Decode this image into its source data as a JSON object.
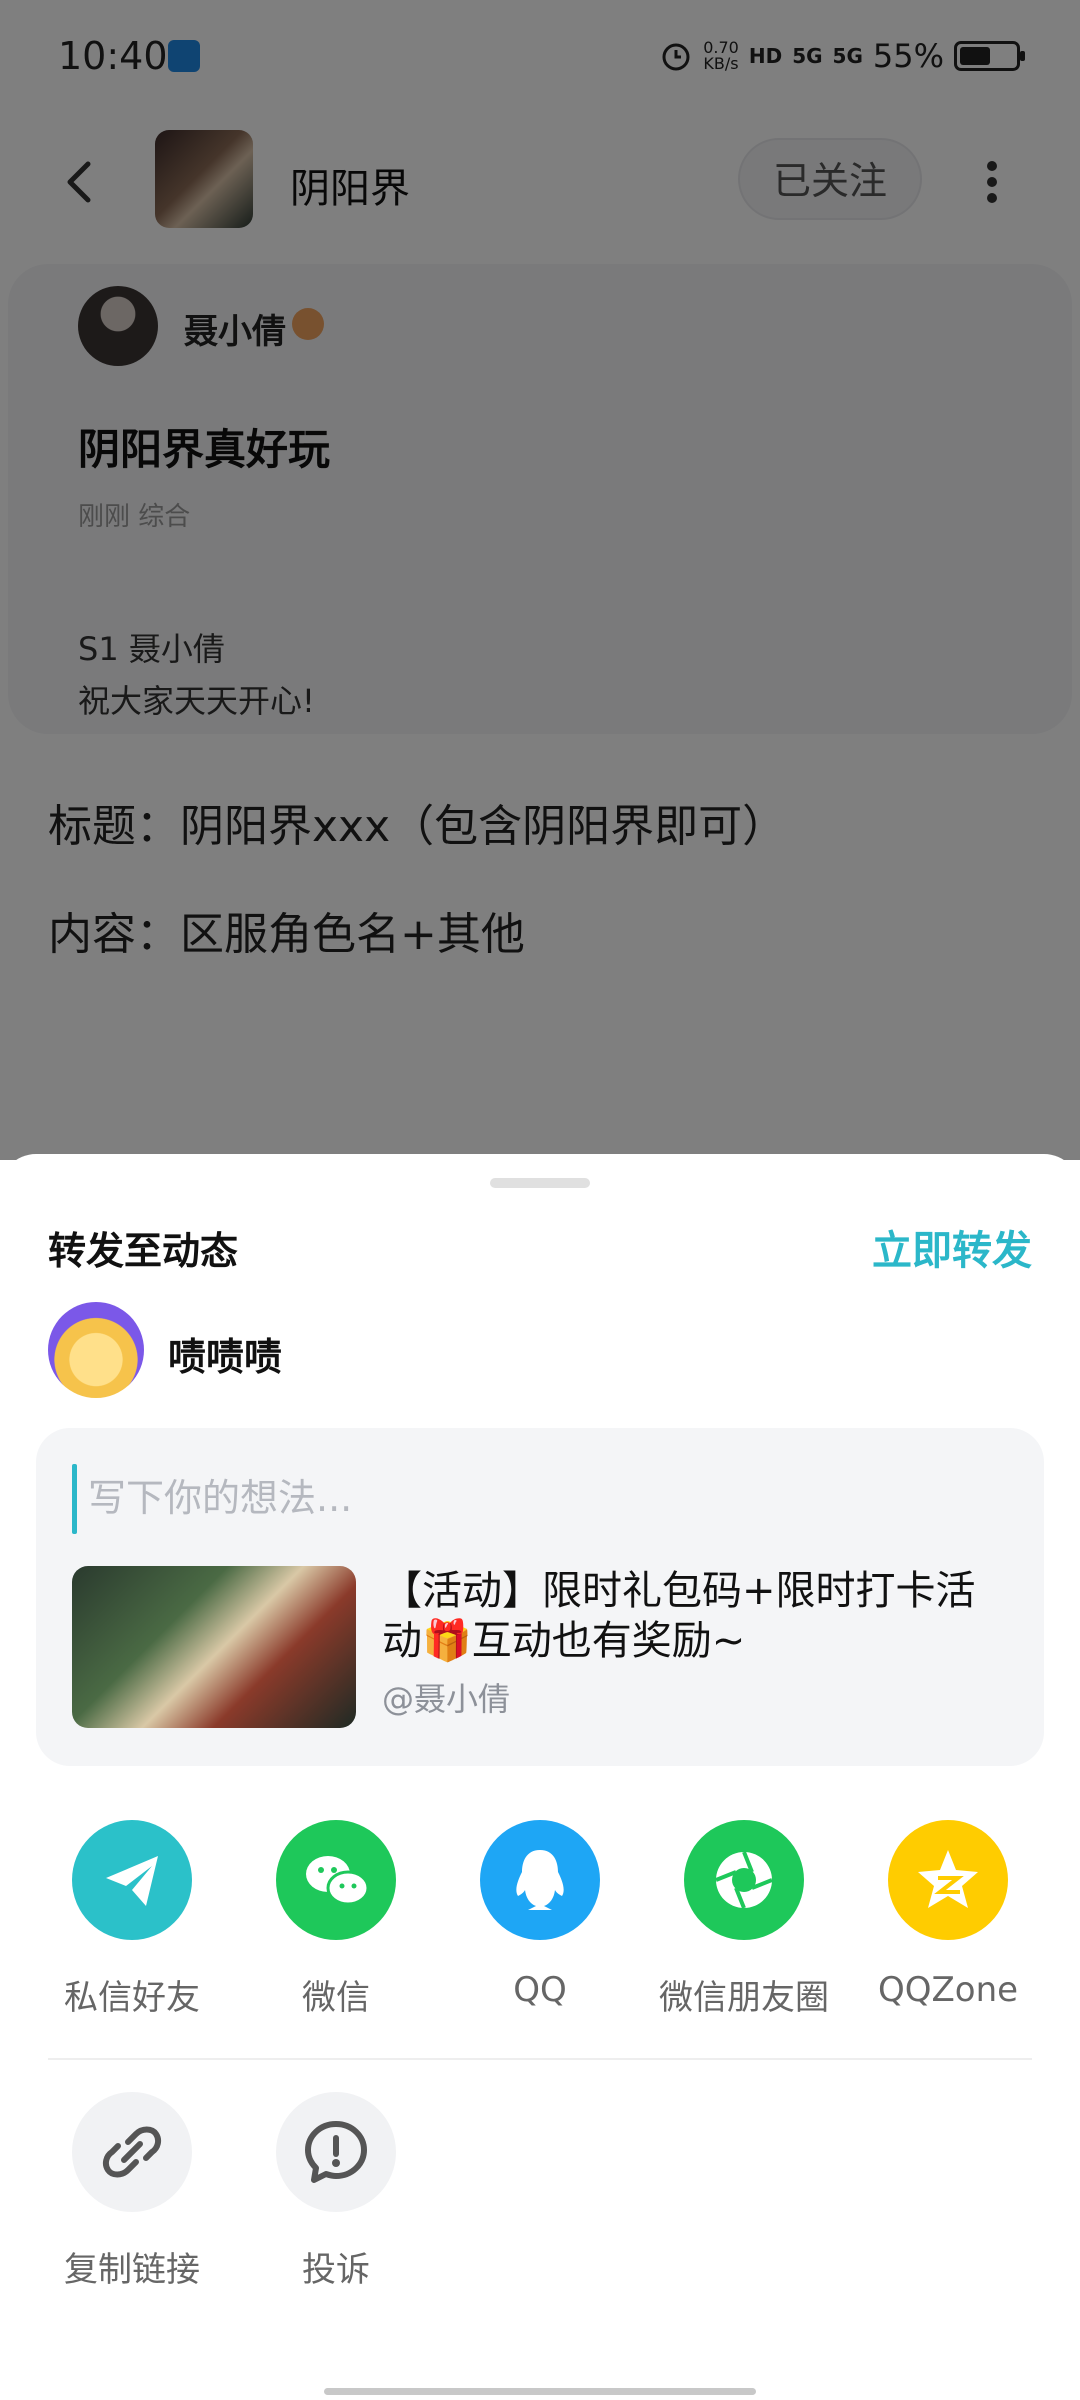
{
  "status_bar": {
    "time": "10:40",
    "net_speed_value": "0.70",
    "net_speed_unit": "KB/s",
    "hd_label": "HD",
    "signal1_label": "5G",
    "signal2_label": "5G",
    "battery_pct": "55%",
    "battery_level": 0.55
  },
  "header": {
    "forum_name": "阴阳界",
    "follow_label": "已关注"
  },
  "post": {
    "author": "聂小倩",
    "title": "阴阳界真好玩",
    "meta": "刚刚  综合",
    "lines": [
      "S1 聂小倩",
      "祝大家天天开心!"
    ],
    "rules": [
      "标题：阴阳界xxx（包含阴阳界即可）",
      "内容：区服角色名+其他"
    ]
  },
  "sheet": {
    "title": "转发至动态",
    "forward_now": "立即转发",
    "user_name": "啧啧啧",
    "compose_placeholder": "写下你的想法...",
    "share_card_title": "【活动】限时礼包码+限时打卡活动🎁互动也有奖励~",
    "share_card_author": "@聂小倩"
  },
  "share_targets": [
    {
      "label": "私信好友",
      "color": "#2bc1c9",
      "icon": "paper-plane-icon"
    },
    {
      "label": "微信",
      "color": "#1ec85a",
      "icon": "wechat-icon"
    },
    {
      "label": "QQ",
      "color": "#1ea6f5",
      "icon": "qq-penguin-icon"
    },
    {
      "label": "微信朋友圈",
      "color": "#1ec85a",
      "icon": "moments-icon"
    },
    {
      "label": "QQZone",
      "color": "#ffcc00",
      "icon": "qzone-star-icon"
    }
  ],
  "actions": [
    {
      "label": "复制链接",
      "icon": "link-icon"
    },
    {
      "label": "投诉",
      "icon": "alert-icon"
    }
  ]
}
